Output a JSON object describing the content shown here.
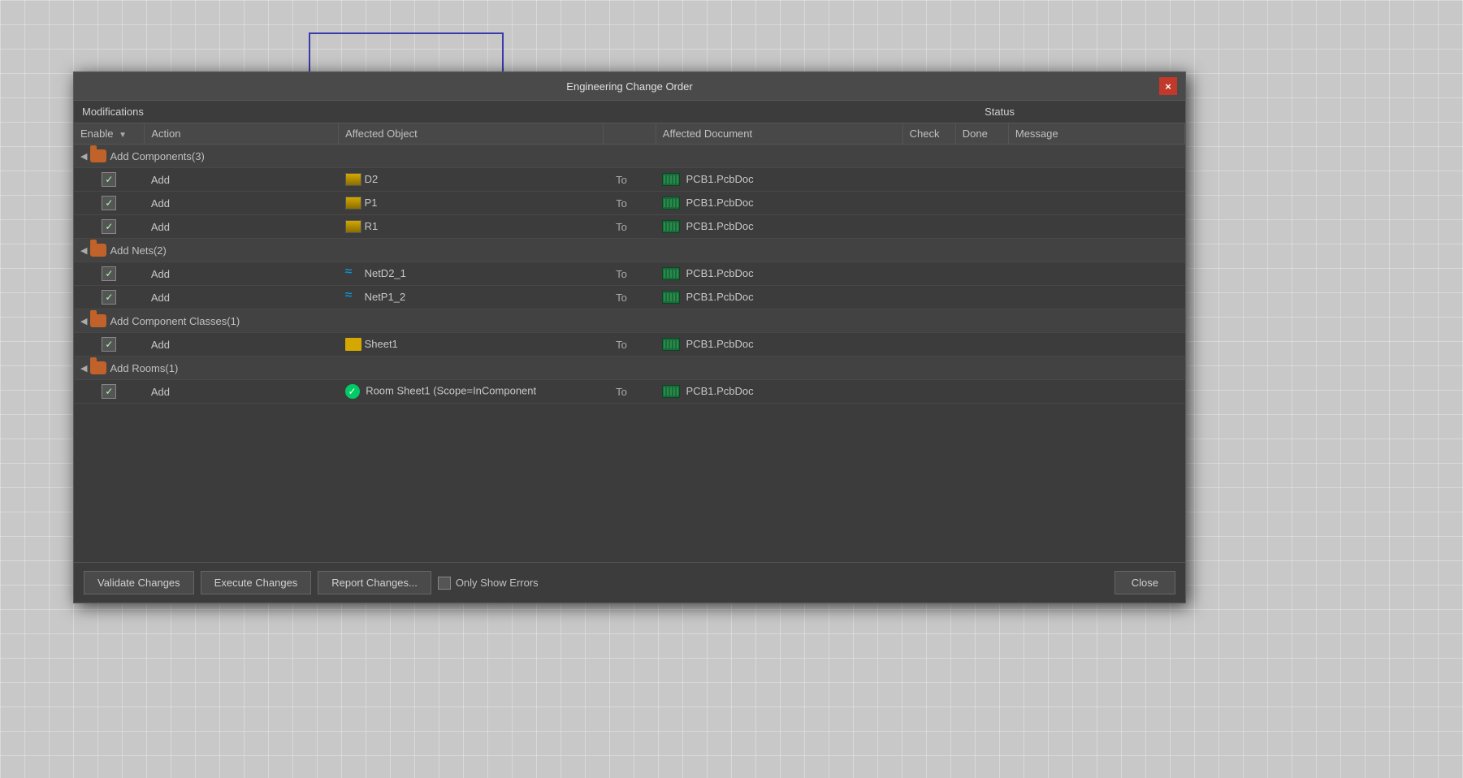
{
  "background": {
    "color": "#c8c8c8"
  },
  "dialog": {
    "title": "Engineering Change Order",
    "close_button": "×",
    "sections": {
      "modifications_label": "Modifications",
      "status_label": "Status"
    },
    "columns": {
      "enable": "Enable",
      "action": "Action",
      "affected_object": "Affected Object",
      "affected_document": "Affected Document",
      "check": "Check",
      "done": "Done",
      "message": "Message"
    },
    "groups": [
      {
        "label": "Add Components(3)",
        "items": [
          {
            "enabled": true,
            "action": "Add",
            "object": "D2",
            "object_type": "component",
            "to": "To",
            "document": "PCB1.PcbDoc"
          },
          {
            "enabled": true,
            "action": "Add",
            "object": "P1",
            "object_type": "component",
            "to": "To",
            "document": "PCB1.PcbDoc"
          },
          {
            "enabled": true,
            "action": "Add",
            "object": "R1",
            "object_type": "component",
            "to": "To",
            "document": "PCB1.PcbDoc"
          }
        ]
      },
      {
        "label": "Add Nets(2)",
        "items": [
          {
            "enabled": true,
            "action": "Add",
            "object": "NetD2_1",
            "object_type": "net",
            "to": "To",
            "document": "PCB1.PcbDoc"
          },
          {
            "enabled": true,
            "action": "Add",
            "object": "NetP1_2",
            "object_type": "net",
            "to": "To",
            "document": "PCB1.PcbDoc"
          }
        ]
      },
      {
        "label": "Add Component Classes(1)",
        "items": [
          {
            "enabled": true,
            "action": "Add",
            "object": "Sheet1",
            "object_type": "component_class",
            "to": "To",
            "document": "PCB1.PcbDoc"
          }
        ]
      },
      {
        "label": "Add Rooms(1)",
        "items": [
          {
            "enabled": true,
            "action": "Add",
            "object": "Room Sheet1 (Scope=InComponent",
            "object_type": "room",
            "to": "To",
            "document": "PCB1.PcbDoc"
          }
        ]
      }
    ],
    "footer": {
      "validate_label": "Validate Changes",
      "execute_label": "Execute Changes",
      "report_label": "Report Changes...",
      "only_show_errors_label": "Only Show Errors",
      "close_label": "Close"
    }
  }
}
